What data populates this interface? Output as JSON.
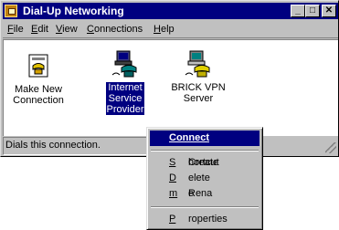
{
  "window": {
    "title": "Dial-Up Networking"
  },
  "title_buttons": {
    "minimize": "_",
    "maximize": "□",
    "close": "✕"
  },
  "menubar": [
    {
      "label": "File",
      "key": "F",
      "rest": "ile"
    },
    {
      "label": "Edit",
      "key": "E",
      "rest": "dit"
    },
    {
      "label": "View",
      "key": "V",
      "rest": "iew"
    },
    {
      "label": "Connections",
      "key": "C",
      "rest": "onnections"
    },
    {
      "label": "Help",
      "key": "H",
      "rest": "elp"
    }
  ],
  "items": [
    {
      "label_line1": "Make New",
      "label_line2": "Connection",
      "label_line3": "",
      "icon": "new-connection-icon"
    },
    {
      "label_line1": "Internet",
      "label_line2": "Service",
      "label_line3": "Provider",
      "icon": "dialup-connection-icon",
      "selected": true
    },
    {
      "label_line1": "BRICK VPN",
      "label_line2": "Server",
      "label_line3": "",
      "icon": "dialup-connection-icon"
    }
  ],
  "status": {
    "text": "Dials this connection."
  },
  "context_menu": {
    "connect": "Connect",
    "create_shortcut_pre": "Create ",
    "create_shortcut_key": "S",
    "create_shortcut_post": "hortcut",
    "delete_key": "D",
    "delete_rest": "elete",
    "rename_pre": "Rena",
    "rename_key": "m",
    "rename_post": "e",
    "properties_key": "P",
    "properties_rest": "roperties"
  },
  "colors": {
    "titlebar": "#000080",
    "face": "#c0c0c0",
    "selection": "#000080"
  }
}
